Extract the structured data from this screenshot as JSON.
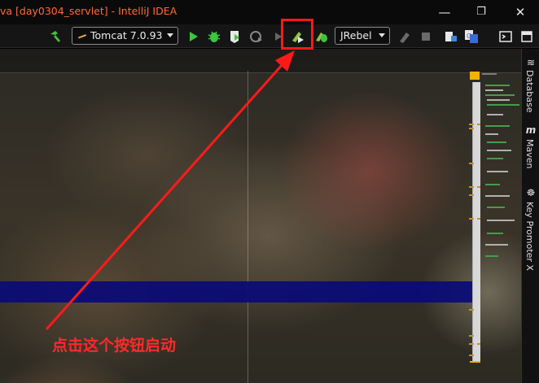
{
  "window": {
    "title": "va [day0304_servlet] - IntelliJ IDEA",
    "controls": {
      "minimize": "—",
      "restore": "❐",
      "close": "✕"
    }
  },
  "toolbar": {
    "run_config": "Tomcat 7.0.93",
    "jrebel_config": "JRebel",
    "icons": [
      "build-hammer-icon",
      "run-config-dropdown",
      "run-icon",
      "debug-icon",
      "coverage-icon",
      "profile-icon",
      "run-disabled-icon",
      "jrebel-run-icon",
      "jrebel-debug-icon",
      "jrebel-dropdown",
      "jrebel-update-icon",
      "stop-icon",
      "project-structure-icon",
      "translate-icon",
      "terminal-icon",
      "maximize-icon"
    ]
  },
  "side_tabs": [
    {
      "label": "Database",
      "icon": "database-icon"
    },
    {
      "label": "Maven",
      "icon": "maven-icon"
    },
    {
      "label": "Key Promoter X",
      "icon": "key-promoter-icon"
    }
  ],
  "annotation": {
    "text": "点击这个按钮启动",
    "color": "#ff2a2a"
  },
  "colors": {
    "accent_red": "#ff1a1a",
    "run_green": "#3ec43e",
    "selection_blue": "#0a0a78",
    "title_orange": "#ff6a3a"
  }
}
